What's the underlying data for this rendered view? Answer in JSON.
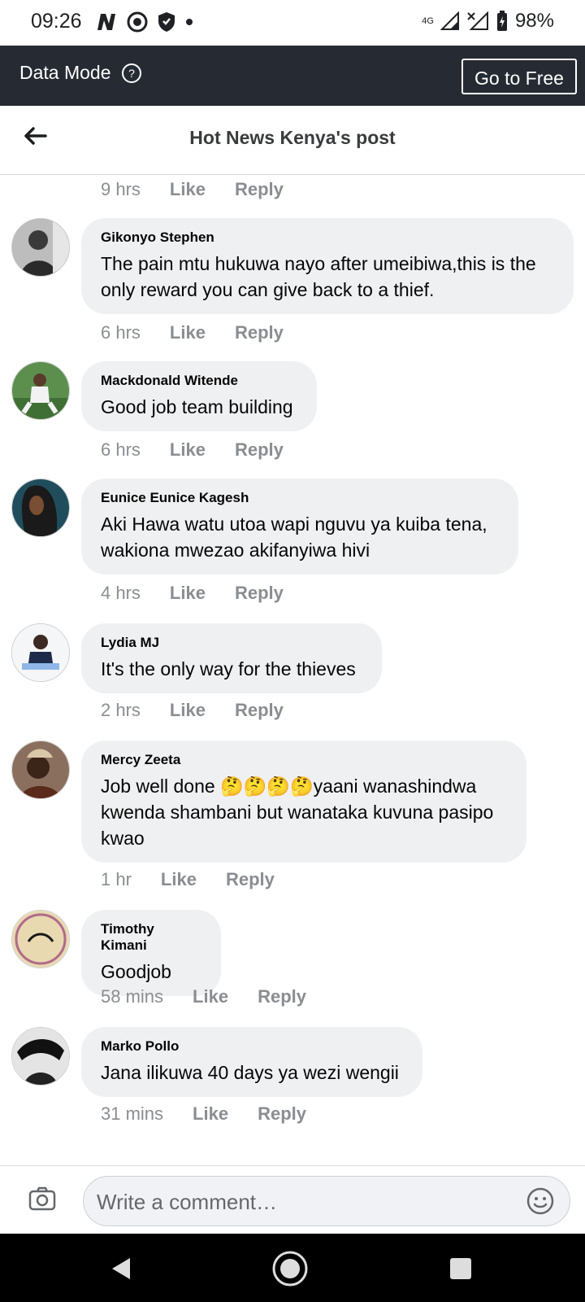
{
  "status_bar": {
    "time": "09:26",
    "network": "4G",
    "battery": "98%"
  },
  "data_mode": {
    "label": "Data Mode",
    "help": "?",
    "button": "Go to Free"
  },
  "header": {
    "title": "Hot News Kenya's post"
  },
  "top_meta": {
    "time": "9 hrs",
    "like": "Like",
    "reply": "Reply"
  },
  "comments": [
    {
      "name": "Gikonyo Stephen",
      "text": "The pain mtu hukuwa nayo after umeibiwa,this is the only reward you can give back to a thief.",
      "time": "6 hrs",
      "like": "Like",
      "reply": "Reply"
    },
    {
      "name": "Mackdonald Witende",
      "text": "Good job team building",
      "time": "6 hrs",
      "like": "Like",
      "reply": "Reply"
    },
    {
      "name": "Eunice Eunice Kagesh",
      "text": "Aki Hawa watu utoa wapi nguvu ya kuiba tena, wakiona mwezao akifanyiwa hivi",
      "time": "4 hrs",
      "like": "Like",
      "reply": "Reply"
    },
    {
      "name": "Lydia MJ",
      "text": "It's the only way for the thieves",
      "time": "2 hrs",
      "like": "Like",
      "reply": "Reply"
    },
    {
      "name": "Mercy Zeeta",
      "text": "Job well done 🤔🤔🤔🤔yaani wanashindwa kwenda shambani but wanataka kuvuna pasipo kwao",
      "time": "1 hr",
      "like": "Like",
      "reply": "Reply"
    },
    {
      "name": "Timothy Kimani",
      "text": "Goodjob",
      "time": "58 mins",
      "like": "Like",
      "reply": "Reply"
    },
    {
      "name": "Marko Pollo",
      "text": "Jana ilikuwa 40 days ya wezi wengii",
      "time": "31 mins",
      "like": "Like",
      "reply": "Reply"
    }
  ],
  "composer": {
    "placeholder": "Write a comment…"
  }
}
